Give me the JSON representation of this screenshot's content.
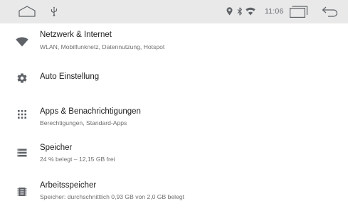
{
  "status_bar": {
    "time": "11:06",
    "icons": [
      "home-icon",
      "usb-icon",
      "location-icon",
      "bluetooth-icon",
      "wifi-icon",
      "recent-apps-icon",
      "back-icon"
    ]
  },
  "settings": {
    "items": [
      {
        "icon": "wifi-icon",
        "title": "Netzwerk & Internet",
        "subtitle": "WLAN, Mobilfunknetz, Datennutzung, Hotspot"
      },
      {
        "icon": "gear-icon",
        "title": "Auto Einstellung",
        "subtitle": ""
      },
      {
        "icon": "apps-grid-icon",
        "title": "Apps & Benachrichtigungen",
        "subtitle": "Berechtigungen, Standard-Apps"
      },
      {
        "icon": "storage-icon",
        "title": "Speicher",
        "subtitle": "24 % belegt – 12,15 GB frei"
      },
      {
        "icon": "memory-icon",
        "title": "Arbeitsspeicher",
        "subtitle": "Speicher: durchschnittlich 0,93 GB von 2,0 GB belegt"
      }
    ]
  }
}
